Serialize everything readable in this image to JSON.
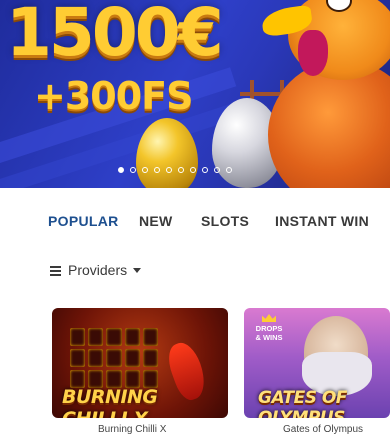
{
  "banner": {
    "headline": "1500€",
    "subline": "+300FS",
    "dots_count": 10,
    "active_dot_index": 0
  },
  "tabs": [
    {
      "label": "POPULAR",
      "active": true
    },
    {
      "label": "NEW",
      "active": false
    },
    {
      "label": "SLOTS",
      "active": false
    },
    {
      "label": "INSTANT WIN",
      "active": false
    }
  ],
  "filter": {
    "providers_label": "Providers",
    "filter_icon": "filter-icon",
    "caret_icon": "caret-down-icon"
  },
  "games": [
    {
      "title_art": "BURNING CHILLI X",
      "caption": "Burning Chilli X"
    },
    {
      "title_art": "GATES OF OLYMPUS",
      "caption": "Gates of Olympus",
      "badge": "DROPS & WINS"
    }
  ],
  "colors": {
    "accent": "#1d4f8f",
    "tab_text": "#3a3a3a",
    "banner_blue": "#2e3fc8",
    "gold_text": "#ffcc33"
  }
}
